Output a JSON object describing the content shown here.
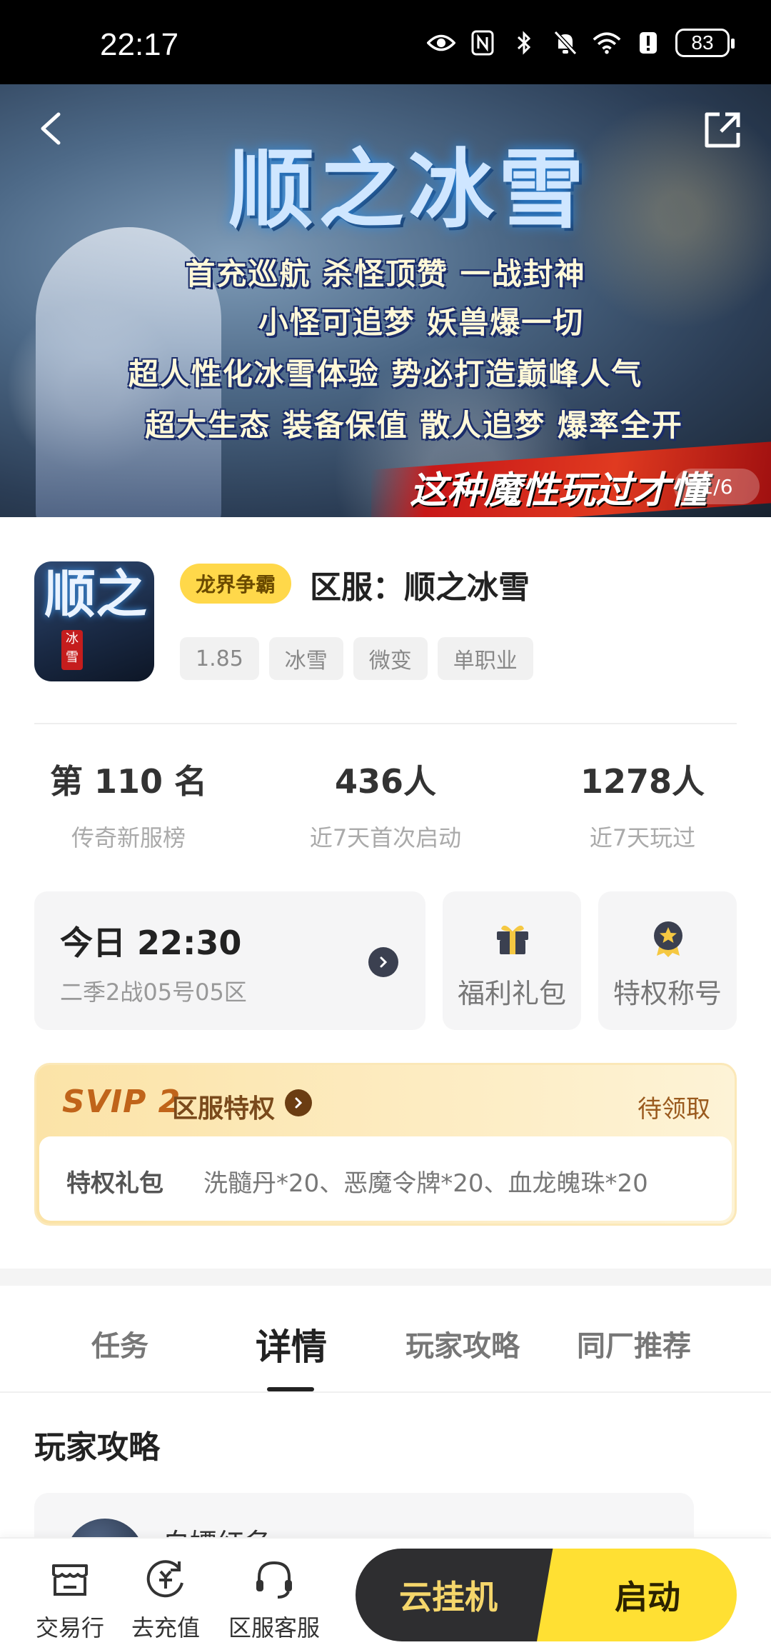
{
  "status_bar": {
    "time": "22:17",
    "battery": "83"
  },
  "banner": {
    "title": "顺之冰雪",
    "slogans": [
      "首充巡航  杀怪顶赞  一战封神",
      "小怪可追梦  妖兽爆一切",
      "超人性化冰雪体验  势必打造巅峰人气",
      "超大生态  装备保值  散人追梦  爆率全开"
    ],
    "tagline": "这种魔性玩过才懂",
    "page_counter": "1/6"
  },
  "game": {
    "icon_text": "顺之",
    "icon_seal": "冰雪",
    "category_tag": "龙界争霸",
    "server_name": "区服：顺之冰雪",
    "tags": [
      "1.85",
      "冰雪",
      "微变",
      "单职业"
    ]
  },
  "stats": [
    {
      "value": "第 110 名",
      "label": "传奇新服榜"
    },
    {
      "value": "436人",
      "label": "近7天首次启动"
    },
    {
      "value": "1278人",
      "label": "近7天玩过"
    }
  ],
  "open_server": {
    "time": "今日 22:30",
    "zone": "二季2战05号05区"
  },
  "quick_actions": [
    {
      "label": "福利礼包",
      "icon": "gift-icon"
    },
    {
      "label": "特权称号",
      "icon": "badge-star-icon"
    }
  ],
  "svip": {
    "logo": "SVIP 2",
    "title": "区服特权",
    "status": "待领取",
    "gift_key": "特权礼包",
    "gift_value": "洗髓丹*20、恶魔令牌*20、血龙魄珠*20"
  },
  "tabs": [
    "任务",
    "详情",
    "玩家攻略",
    "同厂推荐"
  ],
  "active_tab": "详情",
  "section": {
    "title": "玩家攻略"
  },
  "guide": {
    "author": "白嫖红名"
  },
  "bottom_bar": {
    "trade": "交易行",
    "recharge": "去充值",
    "service": "区服客服",
    "cloud": "云挂机",
    "start": "启动"
  },
  "colors": {
    "accent_yellow": "#ffe033",
    "dark_button": "#2e2e30",
    "svip_orange": "#c0641a"
  }
}
